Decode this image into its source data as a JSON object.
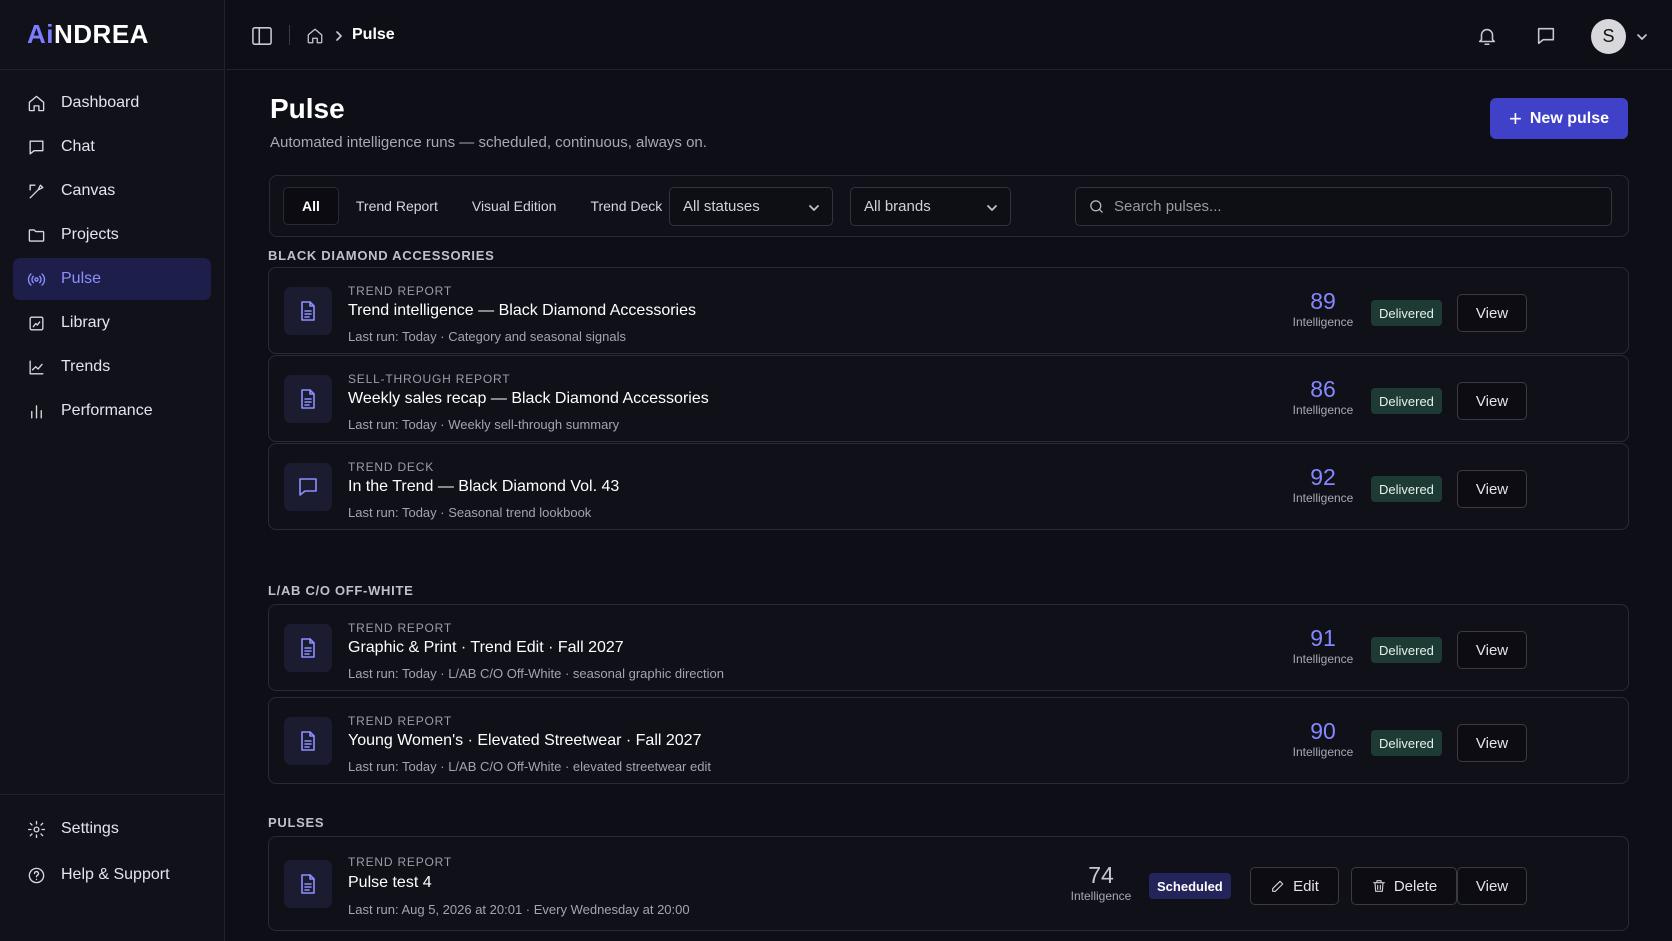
{
  "app": {
    "logo_ai": "Ai",
    "logo_rest": "NDREA"
  },
  "sidebar": {
    "items": [
      {
        "label": "Dashboard",
        "icon": "home-icon"
      },
      {
        "label": "Chat",
        "icon": "chat-icon"
      },
      {
        "label": "Canvas",
        "icon": "canvas-icon"
      },
      {
        "label": "Projects",
        "icon": "folder-icon"
      },
      {
        "label": "Pulse",
        "icon": "pulse-icon",
        "active": true
      },
      {
        "label": "Library",
        "icon": "library-icon"
      },
      {
        "label": "Trends",
        "icon": "trend-icon"
      },
      {
        "label": "Performance",
        "icon": "bar-chart-icon"
      }
    ],
    "bottom": [
      {
        "label": "Settings",
        "icon": "gear-icon"
      },
      {
        "label": "Help & Support",
        "icon": "help-icon"
      }
    ]
  },
  "topbar": {
    "breadcrumb": "Pulse",
    "avatar_initial": "S"
  },
  "header": {
    "title": "Pulse",
    "subtitle": "Automated intelligence runs — scheduled, continuous, always on.",
    "new_button": "New pulse"
  },
  "filters": {
    "tabs": [
      "All",
      "Trend Report",
      "Visual Edition",
      "Trend Deck"
    ],
    "active_tab": "All",
    "status_select": "All statuses",
    "brand_select": "All brands",
    "search_placeholder": "Search pulses..."
  },
  "groups": [
    {
      "label": "BLACK DIAMOND ACCESSORIES",
      "cards": [
        {
          "type": "TREND REPORT",
          "title": "Trend intelligence — Black Diamond Accessories",
          "meta": "Last run: Today · Category and seasonal signals",
          "score": "89",
          "score_label": "Intelligence",
          "status": "Delivered",
          "view": "View",
          "icon": "document-icon"
        },
        {
          "type": "SELL-THROUGH REPORT",
          "title": "Weekly sales recap — Black Diamond Accessories",
          "meta": "Last run: Today · Weekly sell-through summary",
          "score": "86",
          "score_label": "Intelligence",
          "status": "Delivered",
          "view": "View",
          "icon": "document-icon"
        },
        {
          "type": "TREND DECK",
          "title": "In the Trend — Black Diamond Vol. 43",
          "meta": "Last run: Today · Seasonal trend lookbook",
          "score": "92",
          "score_label": "Intelligence",
          "status": "Delivered",
          "view": "View",
          "icon": "deck-icon"
        }
      ]
    },
    {
      "label": "L/AB C/O OFF-WHITE",
      "cards": [
        {
          "type": "TREND REPORT",
          "title": "Graphic & Print · Trend Edit · Fall 2027",
          "meta": "Last run: Today · L/AB C/O Off-White · seasonal graphic direction",
          "score": "91",
          "score_label": "Intelligence",
          "status": "Delivered",
          "view": "View",
          "icon": "document-icon"
        },
        {
          "type": "TREND REPORT",
          "title": "Young Women's · Elevated Streetwear · Fall 2027",
          "meta": "Last run: Today · L/AB C/O Off-White · elevated streetwear edit",
          "score": "90",
          "score_label": "Intelligence",
          "status": "Delivered",
          "view": "View",
          "icon": "document-icon"
        }
      ]
    },
    {
      "label": "PULSES",
      "cards": [
        {
          "type": "TREND REPORT",
          "title": "Pulse test 4",
          "meta": "Last run: Aug 5, 2026 at 20:01 · Every Wednesday at 20:00",
          "score": "74",
          "score_label": "Intelligence",
          "status": "Scheduled",
          "edit": "Edit",
          "delete": "Delete",
          "view": "View",
          "icon": "document-icon"
        }
      ]
    }
  ],
  "colors": {
    "accent": "#3f41c8",
    "accent_text": "#8587ff",
    "delivered_bg": "#1d3a34",
    "scheduled_bg": "#23245a"
  }
}
